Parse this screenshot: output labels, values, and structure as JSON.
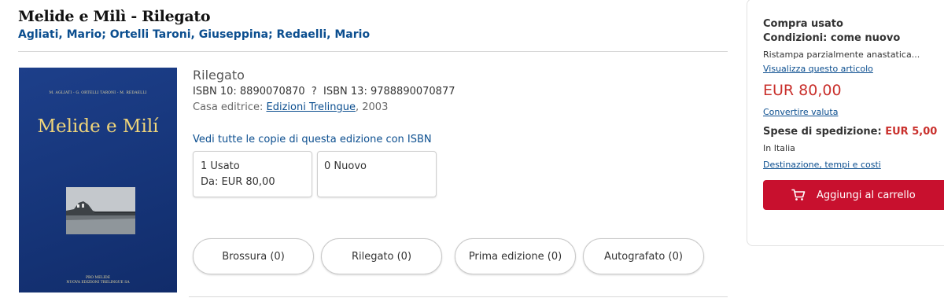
{
  "product": {
    "title": "Melide e Milì - Rilegato",
    "authors": [
      "Agliati, Mario",
      "Ortelli Taroni, Giuseppina",
      "Redaelli, Mario"
    ],
    "author_separator": ";",
    "binding": "Rilegato",
    "isbn_line": "ISBN 10: 8890070870  ?  ISBN 13: 9788890070877",
    "publisher_prefix": "Casa editrice:",
    "publisher_name": "Edizioni Trelingue",
    "publisher_year": ", 2003",
    "see_all_link": "Vedi tutte le copie di questa edizione con ISBN"
  },
  "cover": {
    "authors": "M. AGLIATI - G. ORTELLI TARONI - M. REDAELLI",
    "title": "Melide e Milí",
    "publisher_line1": "PRO MELIDE",
    "publisher_line2": "NUOVA EDIZIONI TRELINGUE SA"
  },
  "offers": {
    "used_count": "1 Usato",
    "used_price": "Da: EUR 80,00",
    "new_count": "0 Nuovo"
  },
  "filters": [
    "Brossura (0)",
    "Rilegato (0)",
    "Prima edizione (0)",
    "Autografato (0)"
  ],
  "panel": {
    "heading": "Compra usato",
    "condition": "Condizioni: come nuovo",
    "description": "Ristampa parzialmente anastatica...",
    "view_link": "Visualizza questo articolo",
    "price": "EUR 80,00",
    "convert_link": "Convertire valuta",
    "shipping_label": "Spese di spedizione:",
    "shipping_price": "EUR 5,00",
    "shipping_region": "In Italia",
    "destination_link": "Destinazione, tempi e costi",
    "cart_button": "Aggiungi al carrello"
  },
  "colors": {
    "link": "#0b4e8f",
    "price": "#c9302c",
    "cart_button": "#c8102e",
    "cover_blue": "#163579",
    "cover_gold": "#f0d57a"
  },
  "icons": {
    "cart": "shopping-cart-icon"
  }
}
